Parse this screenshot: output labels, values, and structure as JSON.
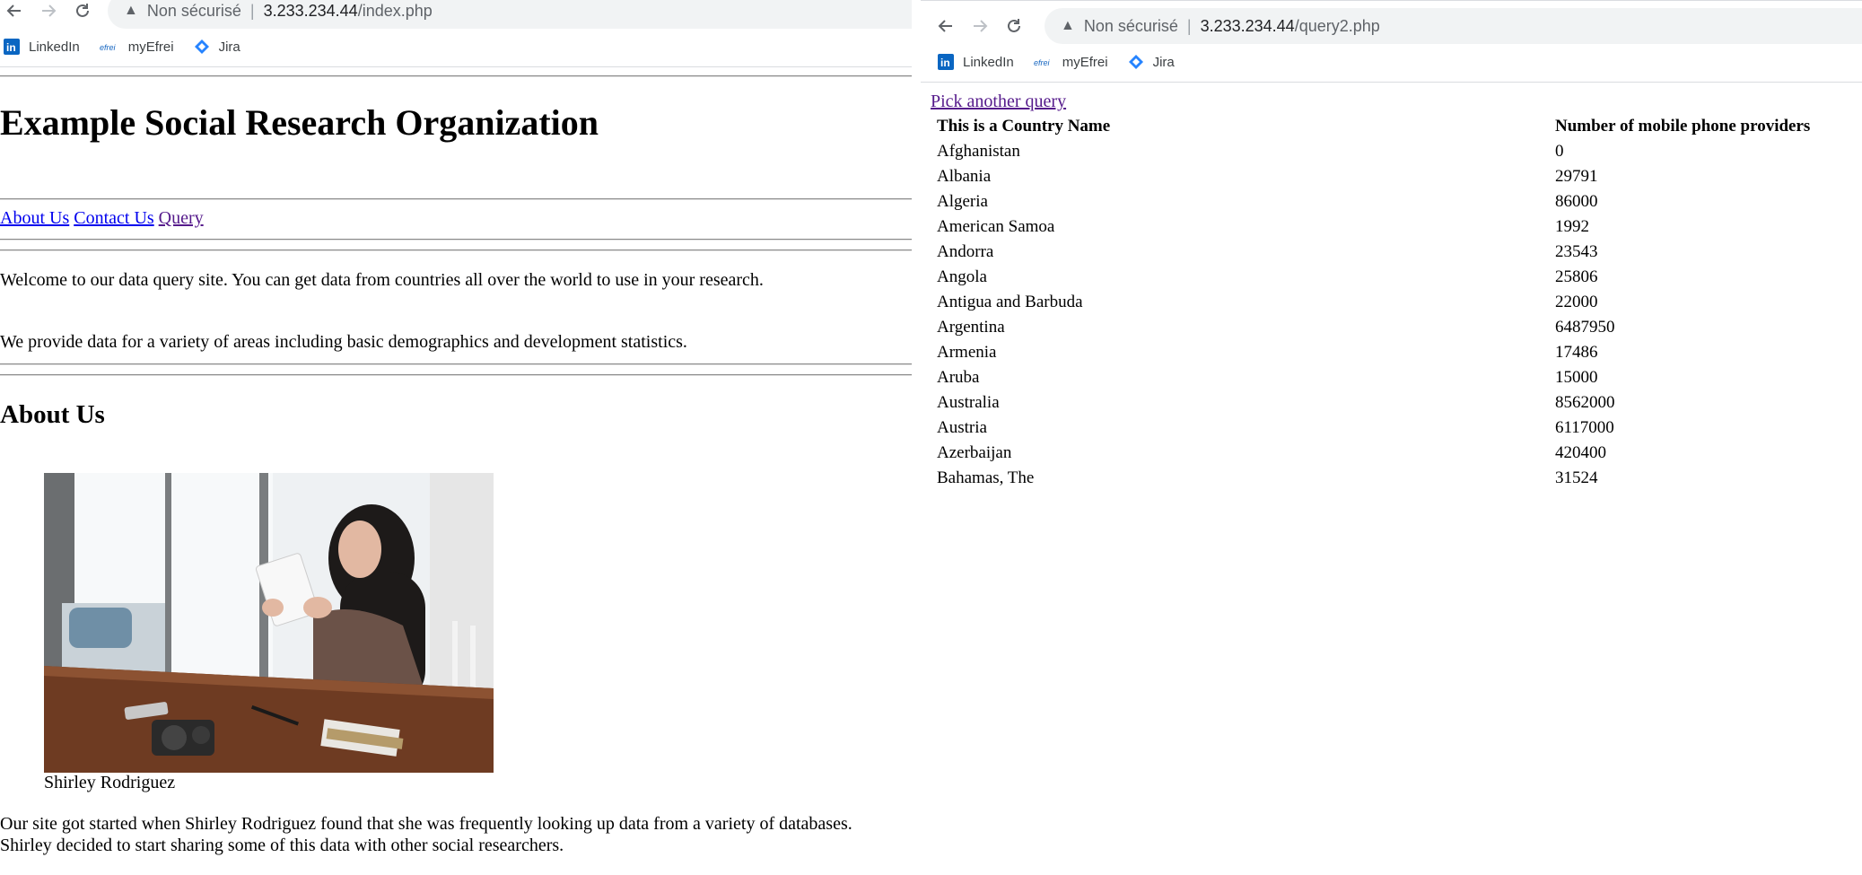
{
  "left_window": {
    "security_label": "Non sécurisé",
    "url_host": "3.233.234.44",
    "url_path": "/index.php",
    "bookmarks": [
      {
        "label": "LinkedIn",
        "icon": "linkedin-icon"
      },
      {
        "label": "myEfrei",
        "icon": "efrei-icon"
      },
      {
        "label": "Jira",
        "icon": "jira-icon"
      }
    ],
    "page": {
      "title": "Example Social Research Organization",
      "nav": [
        "About Us",
        "Contact Us",
        "Query"
      ],
      "welcome": "Welcome to our data query site. You can get data from countries all over the world to use in your research.",
      "provide": "We provide data for a variety of areas including basic demographics and development statistics.",
      "about_heading": "About Us",
      "photo_caption": "Shirley Rodriguez",
      "story_line1": "Our site got started when Shirley Rodriguez found that she was frequently looking up data from a variety of databases.",
      "story_line2": "Shirley decided to start sharing some of this data with other social researchers."
    }
  },
  "right_window": {
    "security_label": "Non sécurisé",
    "url_host": "3.233.234.44",
    "url_path": "/query2.php",
    "bookmarks": [
      {
        "label": "LinkedIn",
        "icon": "linkedin-icon"
      },
      {
        "label": "myEfrei",
        "icon": "efrei-icon"
      },
      {
        "label": "Jira",
        "icon": "jira-icon"
      }
    ],
    "page": {
      "back_link": "Pick another query",
      "columns": [
        "This is a Country Name",
        "Number of mobile phone providers"
      ],
      "rows": [
        [
          "Afghanistan",
          "0"
        ],
        [
          "Albania",
          "29791"
        ],
        [
          "Algeria",
          "86000"
        ],
        [
          "American Samoa",
          "1992"
        ],
        [
          "Andorra",
          "23543"
        ],
        [
          "Angola",
          "25806"
        ],
        [
          "Antigua and Barbuda",
          "22000"
        ],
        [
          "Argentina",
          "6487950"
        ],
        [
          "Armenia",
          "17486"
        ],
        [
          "Aruba",
          "15000"
        ],
        [
          "Australia",
          "8562000"
        ],
        [
          "Austria",
          "6117000"
        ],
        [
          "Azerbaijan",
          "420400"
        ],
        [
          "Bahamas, The",
          "31524"
        ]
      ]
    }
  },
  "colors": {
    "link": "#0000ee",
    "visited_link": "#551a8b",
    "omnibox_bg": "#f1f3f4",
    "linkedin": "#0a66c2",
    "jira": "#2684ff"
  }
}
